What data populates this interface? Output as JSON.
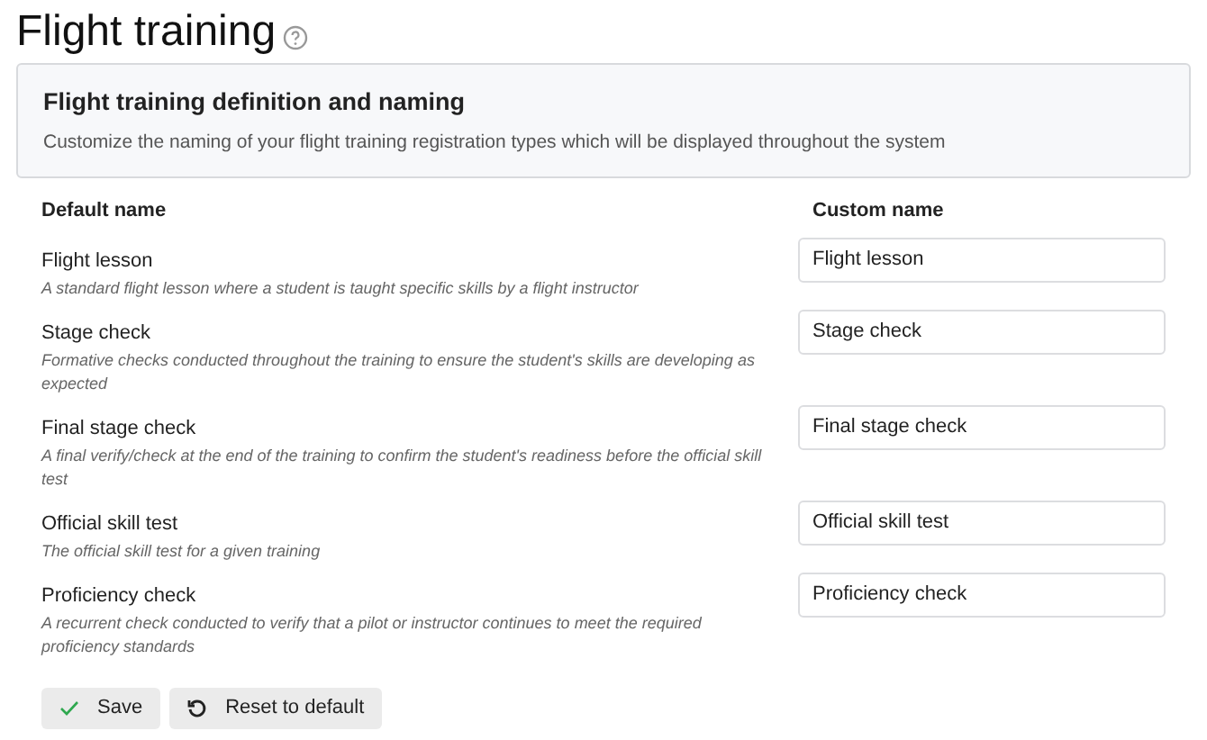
{
  "page": {
    "title": "Flight training"
  },
  "panel": {
    "heading": "Flight training definition and naming",
    "description": "Customize the naming of your flight training registration types which will be displayed throughout the system"
  },
  "table": {
    "columns": [
      "Default name",
      "Custom name"
    ],
    "rows": [
      {
        "name": "Flight lesson",
        "description": "A standard flight lesson where a student is taught specific skills by a flight instructor",
        "custom_name": "Flight lesson"
      },
      {
        "name": "Stage check",
        "description": "Formative checks conducted throughout the training to ensure the student's skills are developing as expected",
        "custom_name": "Stage check"
      },
      {
        "name": "Final stage check",
        "description": "A final verify/check at the end of the training to confirm the student's readiness before the official skill test",
        "custom_name": "Final stage check"
      },
      {
        "name": "Official skill test",
        "description": "The official skill test for a given training",
        "custom_name": "Official skill test"
      },
      {
        "name": "Proficiency check",
        "description": "A recurrent check conducted to verify that a pilot or instructor continues to meet the required proficiency standards",
        "custom_name": "Proficiency check"
      }
    ]
  },
  "buttons": [
    {
      "kind": "save",
      "label": "Save"
    },
    {
      "kind": "reset",
      "label": "Reset to default"
    }
  ]
}
